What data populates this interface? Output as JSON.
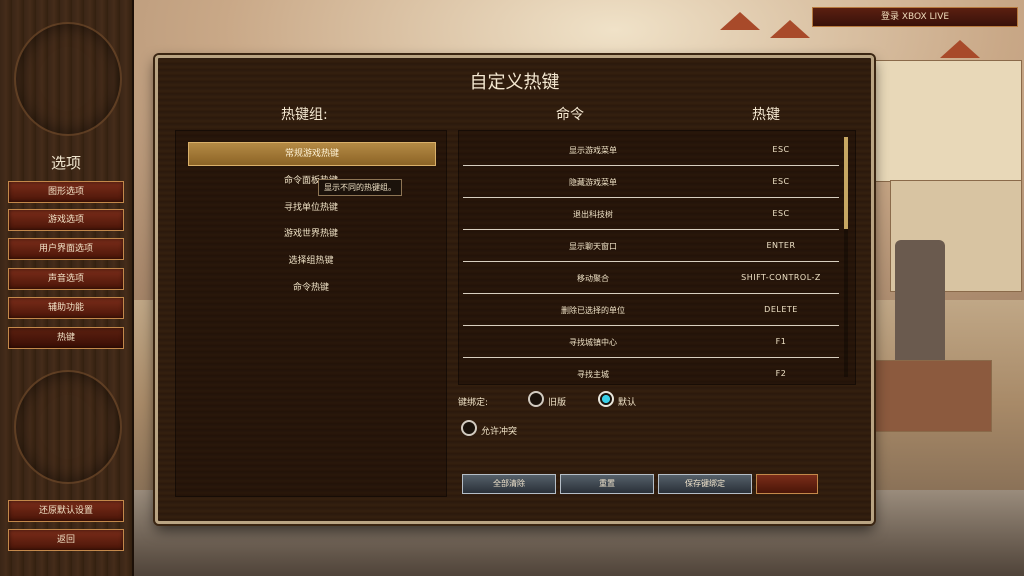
{
  "xbox_label": "登录 XBOX LIVE",
  "sidebar": {
    "title": "选项",
    "items": [
      "图形选项",
      "游戏选项",
      "用户界面选项",
      "声音选项",
      "辅助功能",
      "热键"
    ],
    "active_index": 5,
    "bottom": [
      "还原默认设置",
      "返回"
    ]
  },
  "panel": {
    "title": "自定义热键",
    "group_header": "热键组:",
    "command_header": "命令",
    "hotkey_header": "热键",
    "groups": [
      "常规游戏热键",
      "命令面板热键",
      "寻找单位热键",
      "游戏世界热键",
      "选择组热键",
      "命令热键"
    ],
    "selected_group": 0,
    "tooltip": "显示不同的热键组。",
    "rows": [
      {
        "command": "显示游戏菜单",
        "key": "ESC"
      },
      {
        "command": "隐藏游戏菜单",
        "key": "ESC"
      },
      {
        "command": "退出科技树",
        "key": "ESC"
      },
      {
        "command": "显示聊天窗口",
        "key": "ENTER"
      },
      {
        "command": "移动聚合",
        "key": "SHIFT-CONTROL-Z"
      },
      {
        "command": "删除已选择的单位",
        "key": "DELETE"
      },
      {
        "command": "寻找城镇中心",
        "key": "F1"
      },
      {
        "command": "寻找主城",
        "key": "F2"
      }
    ],
    "binding_label": "键绑定:",
    "binding_options": [
      "旧版",
      "默认"
    ],
    "binding_selected": 1,
    "allow_conflict": "允许冲突",
    "buttons": [
      "全部清除",
      "重置",
      "保存键绑定"
    ]
  },
  "colors": {
    "accent_gold": "#b48a45",
    "button_red": "#7b2d1a",
    "radio_selected": "#39d0e8"
  }
}
